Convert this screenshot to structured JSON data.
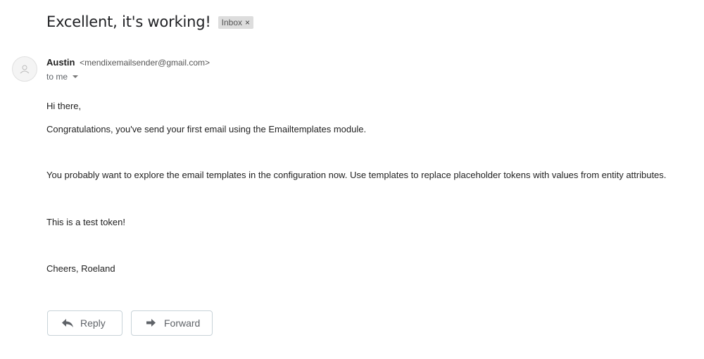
{
  "email": {
    "subject": "Excellent, it's working!",
    "label": "Inbox",
    "label_remove": "×",
    "sender_name": "Austin",
    "sender_email": "<mendixemailsender@gmail.com>",
    "recipient_line": "to me",
    "body": [
      "Hi there,",
      "Congratulations, you've send your first email using the Emailtemplates module.",
      "You probably want to explore the email templates in the configuration now. Use templates to replace placeholder tokens with values from entity attributes.",
      "This is a test token!",
      "Cheers, Roeland"
    ]
  },
  "actions": {
    "reply_label": "Reply",
    "forward_label": "Forward"
  },
  "icons": {
    "avatar": "default-avatar-icon",
    "reply": "reply-arrow-icon",
    "forward": "forward-arrow-icon",
    "details_caret": "caret-down-icon"
  }
}
